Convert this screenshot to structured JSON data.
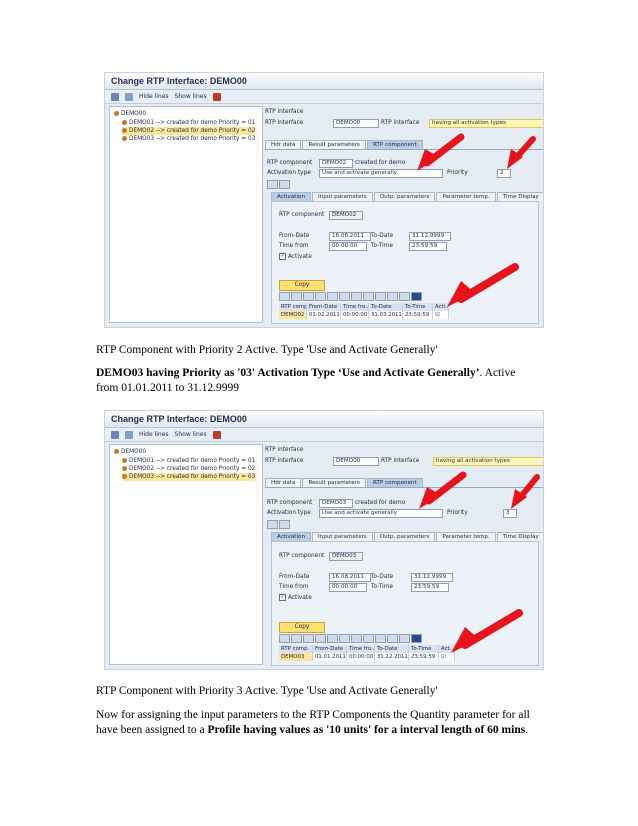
{
  "screens": [
    {
      "window_title": "Change RTP Interface: DEMO00",
      "toolbar": {
        "hide_lines": "Hide lines",
        "show_lines": "Show lines"
      },
      "tree": {
        "root": "DEMO00",
        "items": [
          "DEMO01 --> created for demo Priority = 01",
          "DEMO02 --> created for demo Priority = 02",
          "DEMO03 --> created for demo Priority = 03"
        ],
        "selected_index": 1
      },
      "panel": {
        "section_label": "RTP interface",
        "rtp_interface_label": "RTP interface",
        "rtp_interface_value": "DEMO00",
        "rtp_interface_label2": "RTP interface",
        "rtp_interface_desc": "having all activation types",
        "tabs": [
          "Hdr data",
          "Result parameters",
          "RTP component"
        ],
        "active_tab": 2,
        "rtp_component_label": "RTP component",
        "rtp_component_value": "DEMO02",
        "rtp_component_desc": "created for demo",
        "activation_type_label": "Activation type",
        "activation_type_value": "Use and activate generally",
        "priority_label": "Priority",
        "priority_value": "2",
        "subtabs": [
          "Activation",
          "Input parameters",
          "Outp. parameters",
          "Parameter temp.",
          "Time Display"
        ],
        "active_subtab": 0,
        "sub_rtp_component_label": "RTP component",
        "sub_rtp_component_value": "DEMO02",
        "from_date_label": "From-Date",
        "from_date_value": "16.08.2011",
        "to_date_label": "To-Date",
        "to_date_value": "31.12.9999",
        "time_from_label": "Time from",
        "time_from_value": "00:00:00",
        "to_time_label": "To-Time",
        "to_time_value": "23:59:59",
        "activate_label": "Activate",
        "copy_label": "Copy",
        "grid_headers": [
          "RTP comp.",
          "From-Date",
          "Time fro..",
          "To-Date",
          "To-Time",
          "Acti.."
        ],
        "grid_row": [
          "DEMO02",
          "01.02.2011",
          "00:00:00",
          "31.03.2011",
          "23:59:59",
          "☑"
        ]
      }
    },
    {
      "window_title": "Change RTP Interface: DEMO00",
      "toolbar": {
        "hide_lines": "Hide lines",
        "show_lines": "Show lines"
      },
      "tree": {
        "root": "DEMO00",
        "items": [
          "DEMO01 --> created for demo Priority = 01",
          "DEMO02 --> created for demo Priority = 02",
          "DEMO03 --> created for demo Priority = 03"
        ],
        "selected_index": 2
      },
      "panel": {
        "section_label": "RTP interface",
        "rtp_interface_label": "RTP interface",
        "rtp_interface_value": "DEMO00",
        "rtp_interface_label2": "RTP interface",
        "rtp_interface_desc": "having all activation types",
        "tabs": [
          "Hdr data",
          "Result parameters",
          "RTP component"
        ],
        "active_tab": 2,
        "rtp_component_label": "RTP component",
        "rtp_component_value": "DEMO03",
        "rtp_component_desc": "created for demo",
        "activation_type_label": "Activation type",
        "activation_type_value": "Use and activate generally",
        "priority_label": "Priority",
        "priority_value": "3",
        "subtabs": [
          "Activation",
          "Input parameters",
          "Outp. parameters",
          "Parameter temp.",
          "Time Display"
        ],
        "active_subtab": 0,
        "sub_rtp_component_label": "RTP component",
        "sub_rtp_component_value": "DEMO03",
        "from_date_label": "From-Date",
        "from_date_value": "16.08.2011",
        "to_date_label": "To-Date",
        "to_date_value": "31.12.9999",
        "time_from_label": "Time from",
        "time_from_value": "00:00:00",
        "to_time_label": "To-Time",
        "to_time_value": "23:59:59",
        "activate_label": "Activate",
        "copy_label": "Copy",
        "grid_headers": [
          "RTP comp.",
          "From-Date",
          "Time fro..",
          "To-Date",
          "To-Time",
          "Act.."
        ],
        "grid_row": [
          "DEMO03",
          "01.01.2011",
          "00:00:00",
          "31.12.2011",
          "23:59:59",
          "☑"
        ]
      }
    }
  ],
  "text": {
    "caption1": "RTP Component with Priority 2 Active. Type 'Use and Activate Generally'",
    "para1_bold": "DEMO03 having Priority as '03' Activation Type ‘Use and Activate Generally’",
    "para1_rest": ". Active from 01.01.2011 to 31.12.9999",
    "caption2": "RTP Component with Priority 3 Active. Type 'Use and Activate Generally'",
    "para2_start": "Now for assigning the input parameters to the RTP Components the Quantity parameter for all have been assigned to a ",
    "para2_bold": "Profile having values as '10 units' for a interval length of 60 mins",
    "para2_end": "."
  },
  "colors": {
    "arrow": "#e8141c",
    "selection": "#ffe79a",
    "header_field": "#fff6b8"
  }
}
